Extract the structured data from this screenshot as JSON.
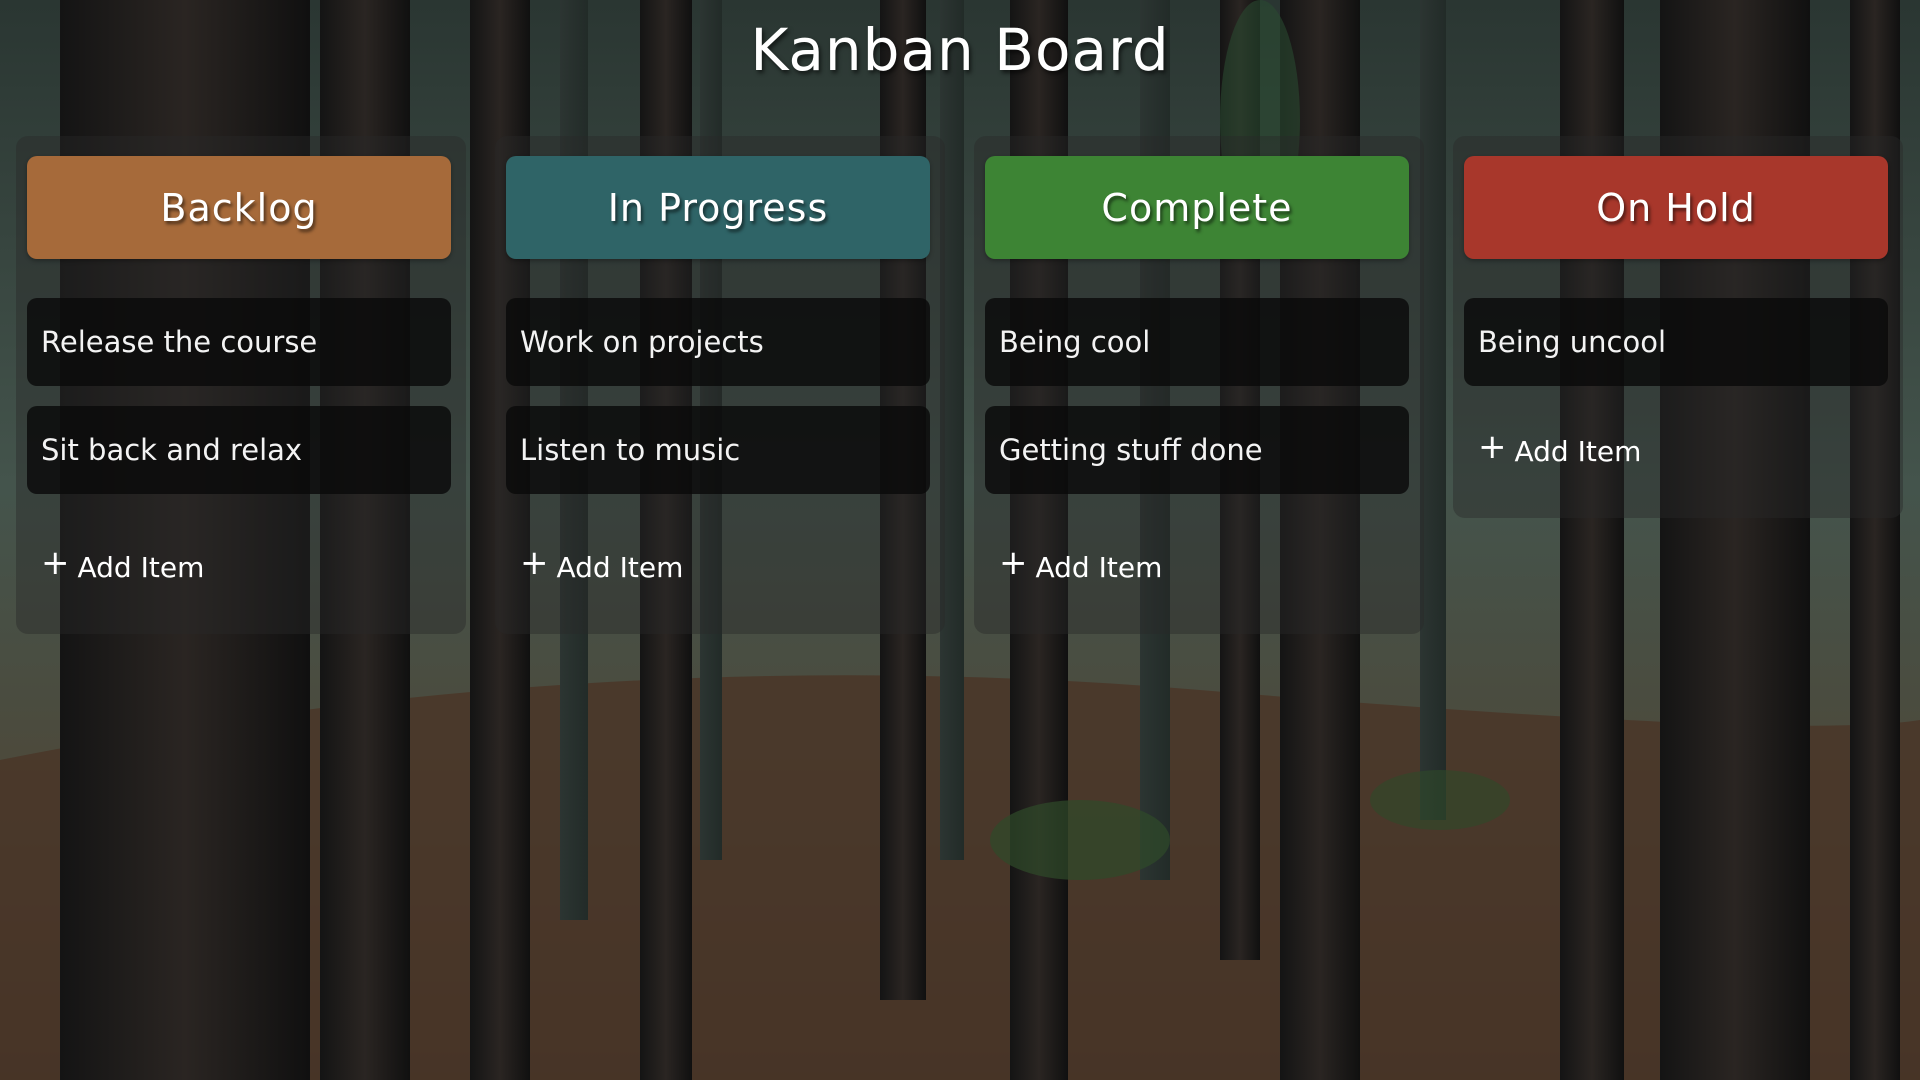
{
  "page": {
    "title": "Kanban Board"
  },
  "add_item_label": "Add Item",
  "add_item_icon": "plus-icon",
  "columns": [
    {
      "title": "Backlog",
      "color": "#A66A3A",
      "items": [
        "Release the course",
        "Sit back and relax"
      ]
    },
    {
      "title": "In Progress",
      "color": "#2F6467",
      "items": [
        "Work on projects",
        "Listen to music"
      ]
    },
    {
      "title": "Complete",
      "color": "#3D8434",
      "items": [
        "Being cool",
        "Getting stuff done"
      ]
    },
    {
      "title": "On Hold",
      "color": "#A8372B",
      "items": [
        "Being uncool"
      ]
    }
  ],
  "background": "forest-photo"
}
